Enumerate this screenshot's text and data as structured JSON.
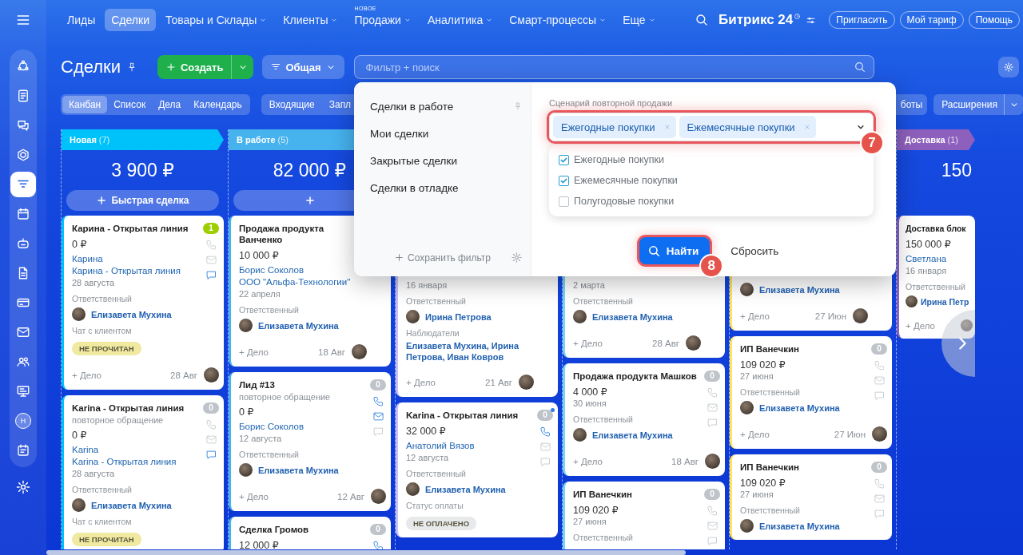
{
  "sidebar": {
    "items": [
      {
        "kind": "icon",
        "selected": false
      },
      {
        "kind": "icon",
        "selected": false
      },
      {
        "kind": "icon",
        "selected": false
      },
      {
        "kind": "icon",
        "selected": false
      },
      {
        "kind": "icon",
        "selected": true
      },
      {
        "kind": "icon",
        "selected": false
      },
      {
        "kind": "icon",
        "selected": false
      },
      {
        "kind": "icon",
        "selected": false
      },
      {
        "kind": "icon",
        "selected": false
      },
      {
        "kind": "icon",
        "selected": false
      },
      {
        "kind": "icon",
        "selected": false
      },
      {
        "kind": "icon",
        "selected": false
      },
      {
        "kind": "avatar",
        "text": "Н",
        "selected": false
      },
      {
        "kind": "icon",
        "selected": false
      }
    ]
  },
  "nav": {
    "items": [
      {
        "label": "Лиды",
        "selected": false,
        "dropdown": false
      },
      {
        "label": "Сделки",
        "selected": true,
        "dropdown": false
      },
      {
        "label": "Товары и Склады",
        "selected": false,
        "dropdown": true
      },
      {
        "label": "Клиенты",
        "selected": false,
        "dropdown": true
      },
      {
        "label": "Продажи",
        "selected": false,
        "dropdown": true,
        "badge": "НОВОЕ"
      },
      {
        "label": "Аналитика",
        "selected": false,
        "dropdown": true
      },
      {
        "label": "Смарт-процессы",
        "selected": false,
        "dropdown": true
      },
      {
        "label": "Еще",
        "selected": false,
        "dropdown": true
      }
    ],
    "logo": "Битрикс 24",
    "buttons": [
      "Пригласить",
      "Мой тариф",
      "Помощь"
    ]
  },
  "header": {
    "title": "Сделки",
    "create_button": "Создать",
    "category_button": "Общая",
    "search": {
      "placeholder": "Фильтр + поиск"
    }
  },
  "toolbar": {
    "views": [
      {
        "label": "Канбан",
        "selected": true
      },
      {
        "label": "Список",
        "selected": false
      },
      {
        "label": "Дела",
        "selected": false
      },
      {
        "label": "Календарь",
        "selected": false
      }
    ],
    "counters": [
      "Входящие",
      "Запл"
    ],
    "robots_button": "боты",
    "extensions_button": "Расширения"
  },
  "filter_popup": {
    "presets": [
      {
        "label": "Сделки в работе",
        "pinned": true
      },
      {
        "label": "Мои сделки",
        "pinned": false
      },
      {
        "label": "Закрытые сделки",
        "pinned": false
      },
      {
        "label": "Сделки в отладке",
        "pinned": false
      }
    ],
    "save_filter": "Сохранить фильтр",
    "field": {
      "label": "Сценарий повторной продажи",
      "tags": [
        "Ежегодные покупки",
        "Ежемесячные покупки"
      ],
      "callout": "7"
    },
    "options": [
      {
        "label": "Ежегодные покупки",
        "checked": true
      },
      {
        "label": "Ежемесячные покупки",
        "checked": true
      },
      {
        "label": "Полугодовые покупки",
        "checked": false
      }
    ],
    "find_button": {
      "label": "Найти",
      "callout": "8"
    },
    "reset_button": "Сбросить"
  },
  "board": {
    "columns": [
      {
        "title": "Новая",
        "count": "(7)",
        "color": "#00c2fa",
        "sum": "3 900 ₽",
        "quick_add": {
          "kind": "labeled",
          "label": "Быстрая сделка"
        },
        "cards": [
          {
            "title": "Карина - Открытая линия",
            "badge": {
              "text": "1",
              "color": "#9dcf00",
              "dot": false
            },
            "contacts": [
              {
                "kind": "phone",
                "active": false
              },
              {
                "kind": "mail",
                "active": false
              },
              {
                "kind": "chat",
                "active": true
              }
            ],
            "fields": [
              {
                "kind": "amount",
                "text": "0 ₽"
              },
              {
                "kind": "link",
                "text": "Карина"
              },
              {
                "kind": "link",
                "text": "Карина - Открытая линия"
              },
              {
                "kind": "date",
                "text": "28 августа"
              },
              {
                "kind": "label",
                "text": "Ответственный"
              },
              {
                "kind": "person",
                "text": "Елизавета Мухина"
              },
              {
                "kind": "label",
                "text": "Чат с клиентом"
              },
              {
                "kind": "tag",
                "text": "НЕ ПРОЧИТАН",
                "color": "#f0e9a0"
              }
            ],
            "footer": {
              "action": "+ Дело",
              "date": "28 Авг"
            }
          },
          {
            "title": "Karina - Открытая линия",
            "badge": {
              "text": "0",
              "color": "#bfc4ca",
              "dot": false
            },
            "contacts": [
              {
                "kind": "phone",
                "active": false
              },
              {
                "kind": "mail",
                "active": false
              },
              {
                "kind": "chat",
                "active": true
              }
            ],
            "fields": [
              {
                "kind": "subtitle",
                "text": "повторное обращение"
              },
              {
                "kind": "amount",
                "text": "0 ₽"
              },
              {
                "kind": "link",
                "text": "Karina"
              },
              {
                "kind": "link",
                "text": "Karina - Открытая линия"
              },
              {
                "kind": "date",
                "text": "28 августа"
              },
              {
                "kind": "label",
                "text": "Ответственный"
              },
              {
                "kind": "person",
                "text": "Елизавета Мухина"
              },
              {
                "kind": "label",
                "text": "Чат с клиентом"
              },
              {
                "kind": "tag",
                "text": "НЕ ПРОЧИТАН",
                "color": "#f0e9a0"
              }
            ]
          }
        ]
      },
      {
        "title": "В работе",
        "count": "(5)",
        "color": "#46b2ee",
        "sum": "82 000 ₽",
        "quick_add": {
          "kind": "icon"
        },
        "cards": [
          {
            "title": "Продажа продукта Ванченко",
            "fields": [
              {
                "kind": "amount",
                "text": "10 000 ₽"
              },
              {
                "kind": "link",
                "text": "Борис Соколов"
              },
              {
                "kind": "link",
                "text": "ООО \"Альфа-Технологии\""
              },
              {
                "kind": "date",
                "text": "22 апреля"
              },
              {
                "kind": "label",
                "text": "Ответственный"
              },
              {
                "kind": "person",
                "text": "Елизавета Мухина"
              }
            ],
            "footer": {
              "action": "+ Дело",
              "date": "18 Авг"
            }
          },
          {
            "title": "Лид #13",
            "badge": {
              "text": "0",
              "color": "#bfc4ca",
              "dot": false
            },
            "contacts": [
              {
                "kind": "phone",
                "active": true
              },
              {
                "kind": "mail",
                "active": true
              },
              {
                "kind": "chat",
                "active": false
              }
            ],
            "fields": [
              {
                "kind": "subtitle",
                "text": "повторное обращение"
              },
              {
                "kind": "amount",
                "text": "0 ₽"
              },
              {
                "kind": "link",
                "text": "Борис Соколов"
              },
              {
                "kind": "date",
                "text": "12 августа"
              },
              {
                "kind": "label",
                "text": "Ответственный"
              },
              {
                "kind": "person",
                "text": "Елизавета Мухина"
              }
            ],
            "footer": {
              "action": "+ Дело",
              "date": "12 Авг"
            }
          },
          {
            "title": "Сделка Громов",
            "badge": {
              "text": "0",
              "color": "#bfc4ca",
              "dot": false
            },
            "contacts": [
              {
                "kind": "phone",
                "active": true
              }
            ],
            "fields": [
              {
                "kind": "amount",
                "text": "12 000 ₽"
              }
            ]
          }
        ]
      },
      {
        "color": "#c4bff6",
        "cards": [
          {
            "clipped_top": true,
            "fields": [
              {
                "kind": "date",
                "text": "16 января"
              },
              {
                "kind": "label",
                "text": "Ответственный"
              },
              {
                "kind": "person",
                "text": "Ирина Петрова"
              },
              {
                "kind": "label",
                "text": "Наблюдатели"
              },
              {
                "kind": "names",
                "text": "Елизавета Мухина, Ирина Петрова, Иван Ковров"
              }
            ],
            "footer": {
              "action": "+ Дело",
              "date": "21 Авг"
            }
          },
          {
            "title": "Karina - Открытая линия",
            "badge": {
              "text": "0",
              "color": "#bfc4ca",
              "dot": true
            },
            "contacts": [
              {
                "kind": "phone",
                "active": true
              },
              {
                "kind": "mail",
                "active": false
              },
              {
                "kind": "chat",
                "active": false
              }
            ],
            "fields": [
              {
                "kind": "amount",
                "text": "32 000 ₽"
              },
              {
                "kind": "link",
                "text": "Анатолий Вязов"
              },
              {
                "kind": "date",
                "text": "12 августа"
              },
              {
                "kind": "label",
                "text": "Ответственный"
              },
              {
                "kind": "person",
                "text": "Елизавета Мухина"
              },
              {
                "kind": "label",
                "text": "Статус оплаты"
              },
              {
                "kind": "tag",
                "text": "НЕ ОПЛАЧЕНО",
                "color": "#e7e9eb"
              }
            ]
          }
        ]
      },
      {
        "color": "#74d4f6",
        "cards": [
          {
            "clipped_top": true,
            "fields": [
              {
                "kind": "date",
                "text": "2 марта"
              },
              {
                "kind": "label",
                "text": "Ответственный"
              },
              {
                "kind": "person",
                "text": "Елизавета Мухина"
              }
            ],
            "footer": {
              "action": "+ Дело",
              "date": "28 Авг"
            }
          },
          {
            "title": "Продажа продукта Машков",
            "badge": {
              "text": "0",
              "color": "#bfc4ca",
              "dot": false
            },
            "contacts": [
              {
                "kind": "phone",
                "active": false
              },
              {
                "kind": "mail",
                "active": false
              },
              {
                "kind": "chat",
                "active": false
              }
            ],
            "fields": [
              {
                "kind": "amount",
                "text": "4 000 ₽"
              },
              {
                "kind": "date",
                "text": "30 июня"
              },
              {
                "kind": "label",
                "text": "Ответственный"
              },
              {
                "kind": "person",
                "text": "Елизавета Мухина"
              }
            ],
            "footer": {
              "action": "+ Дело",
              "date": "18 Авг"
            }
          },
          {
            "title": "ИП Ванечкин",
            "badge": {
              "text": "0",
              "color": "#bfc4ca",
              "dot": false
            },
            "contacts": [
              {
                "kind": "phone",
                "active": false
              },
              {
                "kind": "mail",
                "active": false
              },
              {
                "kind": "chat",
                "active": false
              }
            ],
            "fields": [
              {
                "kind": "amount",
                "text": "109 020 ₽"
              },
              {
                "kind": "date",
                "text": "27 июня"
              },
              {
                "kind": "label",
                "text": "Ответственный"
              }
            ]
          }
        ]
      },
      {
        "color": "#ffe45a",
        "cards": [
          {
            "clipped_top": true,
            "fields": [
              {
                "kind": "person",
                "text": "Елизавета Мухина"
              }
            ],
            "footer": {
              "action": "+ Дело",
              "date": "27 Июн"
            }
          },
          {
            "title": "ИП Ванечкин",
            "badge": {
              "text": "0",
              "color": "#bfc4ca",
              "dot": false
            },
            "contacts": [
              {
                "kind": "phone",
                "active": false
              },
              {
                "kind": "mail",
                "active": false
              },
              {
                "kind": "chat",
                "active": false
              }
            ],
            "fields": [
              {
                "kind": "amount",
                "text": "109 020 ₽"
              },
              {
                "kind": "date",
                "text": "27 июня"
              },
              {
                "kind": "label",
                "text": "Ответственный"
              },
              {
                "kind": "person",
                "text": "Елизавета Мухина"
              }
            ],
            "footer": {
              "action": "+ Дело",
              "date": "27 Июн"
            }
          },
          {
            "title": "ИП Ванечкин",
            "badge": {
              "text": "0",
              "color": "#bfc4ca",
              "dot": false
            },
            "contacts": [
              {
                "kind": "phone",
                "active": false
              },
              {
                "kind": "mail",
                "active": false
              },
              {
                "kind": "chat",
                "active": false
              }
            ],
            "fields": [
              {
                "kind": "amount",
                "text": "109 020 ₽"
              },
              {
                "kind": "date",
                "text": "27 июня"
              },
              {
                "kind": "label",
                "text": "Ответственный"
              },
              {
                "kind": "person",
                "text": "Елизавета Мухина"
              }
            ]
          }
        ]
      },
      {
        "title": "Доставка",
        "count": "(1)",
        "color": "#8e60bd",
        "sum": "150",
        "cards": [
          {
            "title": "Доставка блок",
            "fields": [
              {
                "kind": "amount",
                "text": "150 000 ₽"
              },
              {
                "kind": "link",
                "text": "Светлана"
              },
              {
                "kind": "date",
                "text": "16 января"
              },
              {
                "kind": "label",
                "text": "Ответственный"
              },
              {
                "kind": "person",
                "text": "Ирина Петр"
              }
            ],
            "footer": {
              "action": "+ Дело"
            }
          }
        ]
      }
    ]
  }
}
